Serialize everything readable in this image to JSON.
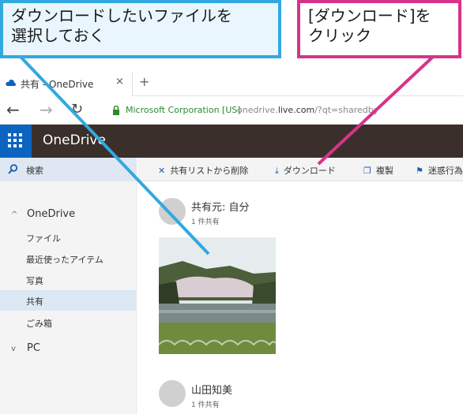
{
  "callouts": {
    "left_line1": "ダウンロードしたいファイルを",
    "left_line2": "選択しておく",
    "right_line1": "[ダウンロード]を",
    "right_line2": "クリック"
  },
  "browser": {
    "tab_title": "共有 - OneDrive",
    "tab_close": "×",
    "new_tab": "+",
    "cert": "Microsoft Corporation [US]",
    "url_prefix": "onedrive.",
    "url_domain": "live.com",
    "url_rest": "/?qt=sharedby"
  },
  "app": {
    "brand": "OneDrive"
  },
  "sidebar": {
    "search_label": "検索",
    "sections": [
      {
        "label": "OneDrive",
        "chevron": "^"
      },
      {
        "label": "PC",
        "chevron": "v"
      }
    ],
    "items": [
      {
        "label": "ファイル"
      },
      {
        "label": "最近使ったアイテム"
      },
      {
        "label": "写真"
      },
      {
        "label": "共有"
      },
      {
        "label": "ごみ箱"
      }
    ]
  },
  "toolbar": {
    "remove_label": "共有リストから削除",
    "download_label": "ダウンロード",
    "copy_label": "複製",
    "spam_label": "迷惑行為"
  },
  "shares": [
    {
      "owner": "共有元: 自分",
      "count": "1 件共有"
    },
    {
      "owner": "山田知美",
      "count": "1 件共有"
    }
  ],
  "colors": {
    "callout_blue": "#33a8e0",
    "callout_pink": "#d6338a",
    "appbar": "#3b2f2b",
    "waffle": "#0c64c0"
  }
}
